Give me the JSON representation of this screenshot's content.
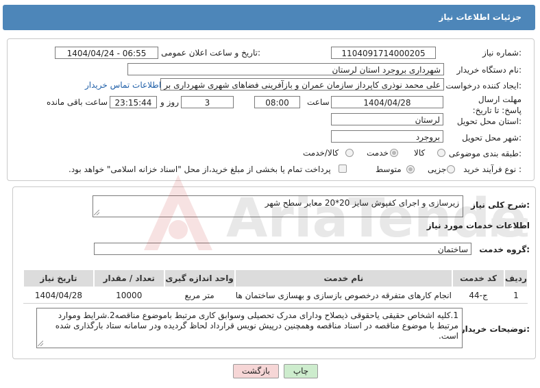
{
  "header": {
    "title": "جزئیات اطلاعات نیاز"
  },
  "form": {
    "need_number": {
      "label": "شماره نیاز:",
      "value": "1104091714000205"
    },
    "announce_datetime": {
      "label": "تاریخ و ساعت اعلان عمومی:",
      "value": "1404/04/24 - 06:55"
    },
    "buyer_org": {
      "label": "نام دستگاه خریدار:",
      "value": "شهرداری بروجرد استان لرستان"
    },
    "requester": {
      "label": "ایجاد کننده درخواست:",
      "value": "علی محمد نوذری کاپرداز سازمان عمران و بازآفرینی فضاهای شهری شهرداری بر",
      "contact_link": "اطلاعات تماس خریدار"
    },
    "deadline": {
      "label": "مهلت ارسال پاسخ: تا تاریخ:",
      "date": "1404/04/28",
      "time_label": "ساعت",
      "time": "08:00",
      "days": "3",
      "days_label": "روز و",
      "remaining": "23:15:44",
      "remaining_label": "ساعت باقی مانده"
    },
    "province": {
      "label": "استان محل تحویل:",
      "value": "لرستان"
    },
    "city": {
      "label": "شهر محل تحویل:",
      "value": "بروجرد"
    },
    "category": {
      "label": "طبقه بندی موضوعی:",
      "options": [
        "کالا",
        "خدمت",
        "کالا/خدمت"
      ],
      "selected": "خدمت"
    },
    "purchase_type": {
      "label": "نوع فرآیند خرید :",
      "options": [
        "جزیی",
        "متوسط"
      ],
      "selected": "متوسط",
      "treasury_note": "پرداخت تمام یا بخشی از مبلغ خرید،از محل \"اسناد خزانه اسلامی\" خواهد بود."
    }
  },
  "summary": {
    "label": "شرح کلی نیاز:",
    "value": "زیرسازی و اجرای کفپوش سایز 20*20 معابر سطح شهر"
  },
  "services": {
    "section_title": "اطلاعات خدمات مورد نیاز",
    "group_label": "گروه خدمت:",
    "group_value": "ساختمان",
    "columns": [
      "ردیف",
      "کد خدمت",
      "نام خدمت",
      "واحد اندازه گیری",
      "تعداد / مقدار",
      "تاریخ نیاز"
    ],
    "rows": [
      [
        "1",
        "ج-44",
        "انجام کارهای متفرقه درخصوص بازسازی و بهسازی ساختمان ها",
        "متر مربع",
        "10000",
        "1404/04/28"
      ]
    ]
  },
  "buyer_notes": {
    "label": "توضیحات خریدار:",
    "value": "1.کلیه اشخاص حقیقی یاحقوقی ذیصلاح ودارای مدرک تحصیلی وسوابق کاری مرتبط باموضوع مناقصه2.شرایط وموارد مرتبط با موضوع مناقصه در اسناد مناقصه وهمچنین درپیش نویس قرارداد لحاظ گردیده ودر سامانه ستاد بارگذاری شده است."
  },
  "buttons": {
    "print": "چاپ",
    "back": "بازگشت"
  },
  "colors": {
    "header": "#4d86b9",
    "print_button": "#cdeccd",
    "back_button": "#f6d6d6"
  }
}
